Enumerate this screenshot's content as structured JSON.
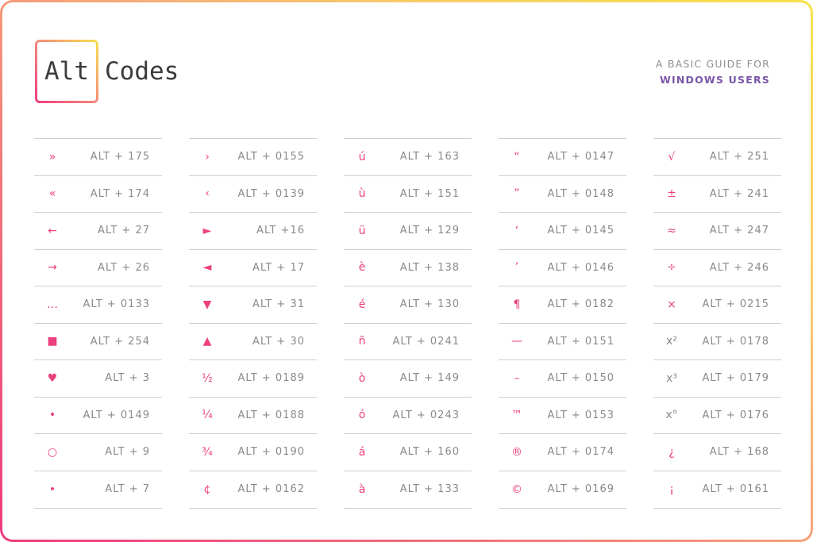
{
  "header": {
    "logo_boxed": "Alt",
    "logo_rest": "Codes",
    "subtitle_line1": "A BASIC GUIDE FOR",
    "subtitle_line2": "WINDOWS USERS"
  },
  "colors": {
    "accent_pink": "#ec3f7e",
    "accent_purple": "#7a55a8",
    "text_gray": "#8a8a8a",
    "border_gradient": [
      "#ee3a7e",
      "#f6a87a",
      "#f7e24a"
    ]
  },
  "columns": [
    [
      {
        "symbol": "»",
        "code": "ALT + 175"
      },
      {
        "symbol": "«",
        "code": "ALT + 174"
      },
      {
        "symbol": "←",
        "code": "ALT + 27"
      },
      {
        "symbol": "→",
        "code": "ALT + 26"
      },
      {
        "symbol": "…",
        "code": "ALT + 0133"
      },
      {
        "symbol": "■",
        "code": "ALT + 254"
      },
      {
        "symbol": "♥",
        "code": "ALT + 3"
      },
      {
        "symbol": "•",
        "code": "ALT + 0149"
      },
      {
        "symbol": "○",
        "code": "ALT + 9"
      },
      {
        "symbol": "•",
        "code": "ALT + 7"
      }
    ],
    [
      {
        "symbol": "›",
        "code": "ALT + 0155"
      },
      {
        "symbol": "‹",
        "code": "ALT + 0139"
      },
      {
        "symbol": "►",
        "code": "ALT +16"
      },
      {
        "symbol": "◄",
        "code": "ALT + 17"
      },
      {
        "symbol": "▼",
        "code": "ALT + 31"
      },
      {
        "symbol": "▲",
        "code": "ALT + 30"
      },
      {
        "symbol": "½",
        "code": "ALT + 0189"
      },
      {
        "symbol": "¼",
        "code": "ALT + 0188"
      },
      {
        "symbol": "¾",
        "code": "ALT + 0190"
      },
      {
        "symbol": "¢",
        "code": "ALT + 0162"
      }
    ],
    [
      {
        "symbol": "ú",
        "code": "ALT + 163"
      },
      {
        "symbol": "ù",
        "code": "ALT + 151"
      },
      {
        "symbol": "ü",
        "code": "ALT + 129"
      },
      {
        "symbol": "è",
        "code": "ALT + 138"
      },
      {
        "symbol": "é",
        "code": "ALT + 130"
      },
      {
        "symbol": "ñ",
        "code": "ALT + 0241"
      },
      {
        "symbol": "ò",
        "code": "ALT + 149"
      },
      {
        "symbol": "ó",
        "code": "ALT + 0243"
      },
      {
        "symbol": "á",
        "code": "ALT + 160"
      },
      {
        "symbol": "à",
        "code": "ALT + 133"
      }
    ],
    [
      {
        "symbol": "“",
        "code": "ALT + 0147"
      },
      {
        "symbol": "”",
        "code": "ALT + 0148"
      },
      {
        "symbol": "‘",
        "code": "ALT + 0145"
      },
      {
        "symbol": "’",
        "code": "ALT + 0146"
      },
      {
        "symbol": "¶",
        "code": "ALT + 0182"
      },
      {
        "symbol": "—",
        "code": "ALT + 0151"
      },
      {
        "symbol": "–",
        "code": "ALT + 0150"
      },
      {
        "symbol": "™",
        "code": "ALT + 0153"
      },
      {
        "symbol": "®",
        "code": "ALT + 0174"
      },
      {
        "symbol": "©",
        "code": "ALT + 0169"
      }
    ],
    [
      {
        "symbol": "√",
        "code": "ALT + 251"
      },
      {
        "symbol": "±",
        "code": "ALT + 241"
      },
      {
        "symbol": "≈",
        "code": "ALT + 247"
      },
      {
        "symbol": "÷",
        "code": "ALT + 246"
      },
      {
        "symbol": "×",
        "code": "ALT + 0215"
      },
      {
        "symbol": "x²",
        "code": "ALT + 0178",
        "muted": true
      },
      {
        "symbol": "x³",
        "code": "ALT + 0179",
        "muted": true
      },
      {
        "symbol": "x°",
        "code": "ALT + 0176",
        "muted": true
      },
      {
        "symbol": "¿",
        "code": "ALT + 168"
      },
      {
        "symbol": "¡",
        "code": "ALT + 0161"
      }
    ]
  ]
}
